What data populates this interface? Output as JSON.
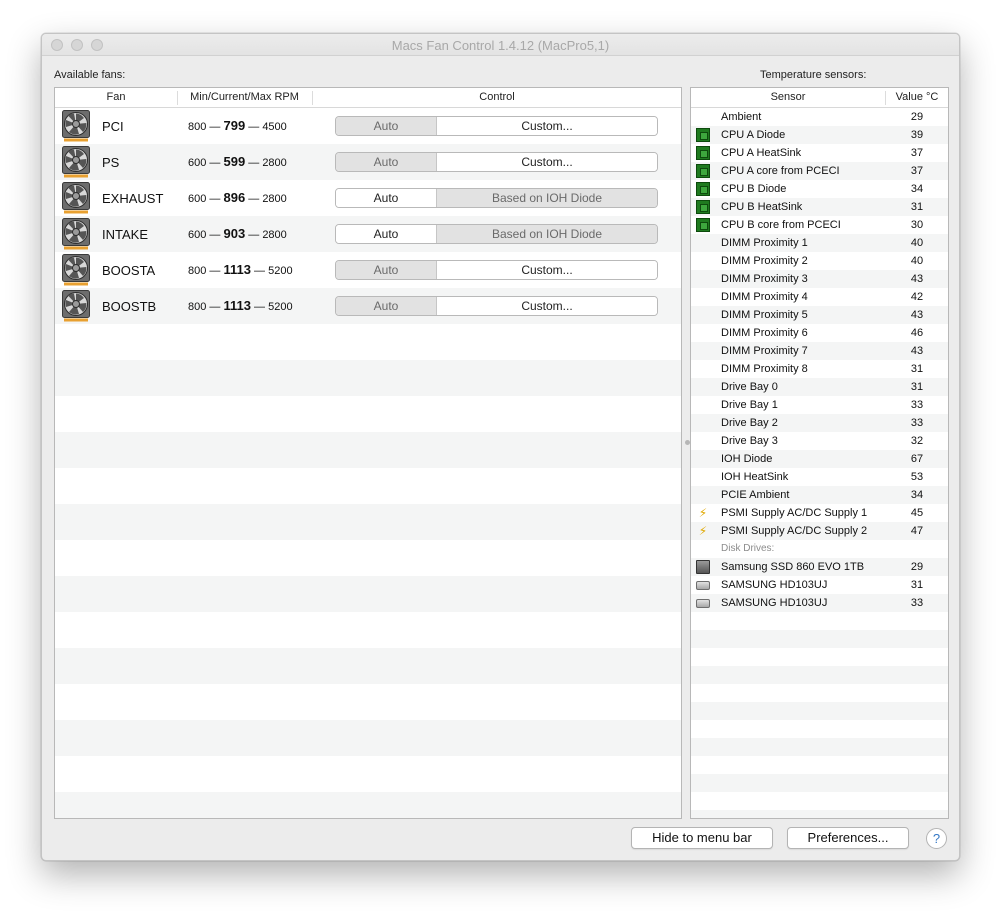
{
  "window": {
    "title": "Macs Fan Control 1.4.12 (MacPro5,1)"
  },
  "fans": {
    "section_label": "Available fans:",
    "headers": {
      "fan": "Fan",
      "rpm": "Min/Current/Max RPM",
      "control": "Control"
    },
    "rows": [
      {
        "name": "PCI",
        "min": "800",
        "current": "799",
        "max": "4500",
        "left": "Auto",
        "right": "Custom...",
        "active": "right"
      },
      {
        "name": "PS",
        "min": "600",
        "current": "599",
        "max": "2800",
        "left": "Auto",
        "right": "Custom...",
        "active": "right"
      },
      {
        "name": "EXHAUST",
        "min": "600",
        "current": "896",
        "max": "2800",
        "left": "Auto",
        "right": "Based on IOH Diode",
        "active": "left"
      },
      {
        "name": "INTAKE",
        "min": "600",
        "current": "903",
        "max": "2800",
        "left": "Auto",
        "right": "Based on IOH Diode",
        "active": "left"
      },
      {
        "name": "BOOSTA",
        "min": "800",
        "current": "1113",
        "max": "5200",
        "left": "Auto",
        "right": "Custom...",
        "active": "right"
      },
      {
        "name": "BOOSTB",
        "min": "800",
        "current": "1113",
        "max": "5200",
        "left": "Auto",
        "right": "Custom...",
        "active": "right"
      }
    ],
    "dash": "—"
  },
  "sensors": {
    "section_label": "Temperature sensors:",
    "headers": {
      "sensor": "Sensor",
      "value": "Value °C"
    },
    "rows": [
      {
        "icon": "none",
        "name": "Ambient",
        "value": "29"
      },
      {
        "icon": "chip-icon",
        "name": "CPU A Diode",
        "value": "39"
      },
      {
        "icon": "chip-icon",
        "name": "CPU A HeatSink",
        "value": "37"
      },
      {
        "icon": "chip-icon",
        "name": "CPU A core from PCECI",
        "value": "37"
      },
      {
        "icon": "chip-icon",
        "name": "CPU B Diode",
        "value": "34"
      },
      {
        "icon": "chip-icon",
        "name": "CPU B HeatSink",
        "value": "31"
      },
      {
        "icon": "chip-icon",
        "name": "CPU B core from PCECI",
        "value": "30"
      },
      {
        "icon": "none",
        "name": "DIMM Proximity 1",
        "value": "40"
      },
      {
        "icon": "none",
        "name": "DIMM Proximity 2",
        "value": "40"
      },
      {
        "icon": "none",
        "name": "DIMM Proximity 3",
        "value": "43"
      },
      {
        "icon": "none",
        "name": "DIMM Proximity 4",
        "value": "42"
      },
      {
        "icon": "none",
        "name": "DIMM Proximity 5",
        "value": "43"
      },
      {
        "icon": "none",
        "name": "DIMM Proximity 6",
        "value": "46"
      },
      {
        "icon": "none",
        "name": "DIMM Proximity 7",
        "value": "43"
      },
      {
        "icon": "none",
        "name": "DIMM Proximity 8",
        "value": "31"
      },
      {
        "icon": "none",
        "name": "Drive Bay 0",
        "value": "31"
      },
      {
        "icon": "none",
        "name": "Drive Bay 1",
        "value": "33"
      },
      {
        "icon": "none",
        "name": "Drive Bay 2",
        "value": "33"
      },
      {
        "icon": "none",
        "name": "Drive Bay 3",
        "value": "32"
      },
      {
        "icon": "none",
        "name": "IOH Diode",
        "value": "67"
      },
      {
        "icon": "none",
        "name": "IOH HeatSink",
        "value": "53"
      },
      {
        "icon": "none",
        "name": "PCIE Ambient",
        "value": "34"
      },
      {
        "icon": "lightning-icon",
        "name": "PSMI Supply AC/DC Supply 1",
        "value": "45"
      },
      {
        "icon": "lightning-icon",
        "name": "PSMI Supply AC/DC Supply 2",
        "value": "47"
      },
      {
        "icon": "group",
        "name": "Disk Drives:",
        "value": ""
      },
      {
        "icon": "ssd-icon",
        "name": "Samsung SSD 860 EVO 1TB",
        "value": "29"
      },
      {
        "icon": "hard-drive-icon",
        "name": "SAMSUNG HD103UJ",
        "value": "31"
      },
      {
        "icon": "hard-drive-icon",
        "name": "SAMSUNG HD103UJ",
        "value": "33"
      }
    ]
  },
  "footer": {
    "hide_label": "Hide to menu bar",
    "prefs_label": "Preferences...",
    "help_label": "?"
  }
}
